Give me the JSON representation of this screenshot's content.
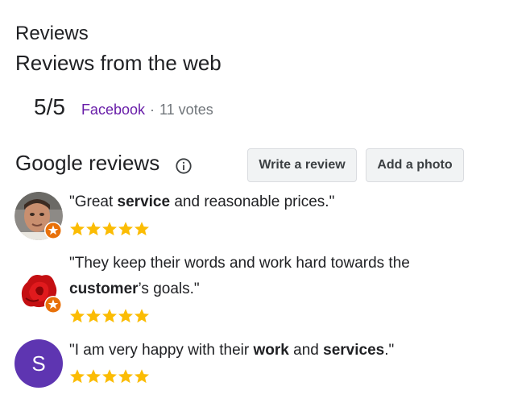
{
  "reviews_section": {
    "title": "Reviews",
    "web_title": "Reviews from the web",
    "web_item": {
      "score": "5/5",
      "source": "Facebook",
      "separator": "·",
      "votes": "11 votes"
    }
  },
  "google_reviews": {
    "title": "Google reviews",
    "info_icon": "info-circle-icon",
    "buttons": {
      "write_review": "Write a review",
      "add_photo": "Add a photo"
    },
    "star_color": "#fbbc04",
    "badge_color": "#e8710a",
    "items": [
      {
        "avatar": "man-photo",
        "quote_parts": [
          "\"Great ",
          "service",
          " and reasonable prices.\""
        ],
        "rating": 5,
        "local_guide_badge": true
      },
      {
        "avatar": "red-rose-photo",
        "quote_line1": "\"They keep their words and work hard towards the",
        "quote_line2_parts": [
          "customer",
          "’s goals.\""
        ],
        "rating": 5,
        "local_guide_badge": true
      },
      {
        "avatar_letter": "S",
        "avatar_color": "#5e35b1",
        "quote_parts": [
          "\"I am very happy with their ",
          "work",
          " and ",
          "services",
          ".\""
        ],
        "rating": 5,
        "local_guide_badge": false
      }
    ]
  }
}
